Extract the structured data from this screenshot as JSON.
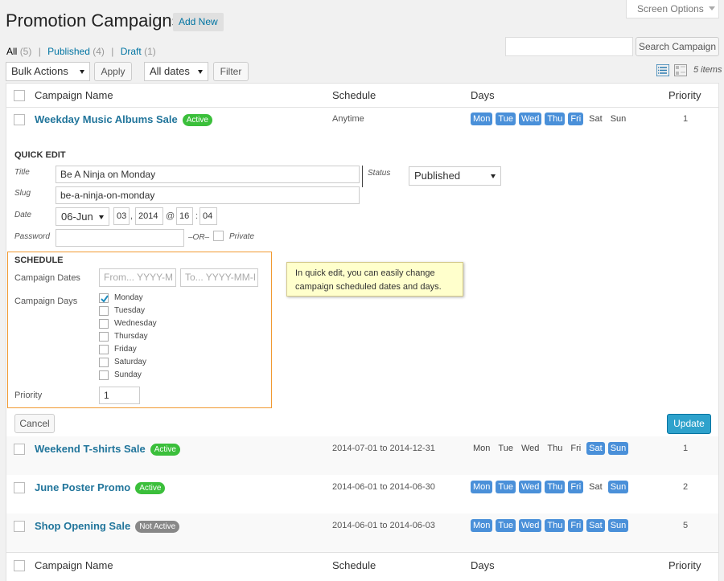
{
  "header": {
    "title": "Promotion Campaigns",
    "add_new": "Add New",
    "screen_options": "Screen Options"
  },
  "filters": {
    "all": "All",
    "all_count": "(5)",
    "published": "Published",
    "published_count": "(4)",
    "draft": "Draft",
    "draft_count": "(1)",
    "sep": "|"
  },
  "search": {
    "button": "Search Campaign",
    "value": ""
  },
  "toolbar": {
    "bulk_actions": "Bulk Actions",
    "apply": "Apply",
    "dates": "All dates",
    "filter": "Filter",
    "items": "5 items"
  },
  "columns": {
    "name": "Campaign Name",
    "schedule": "Schedule",
    "days": "Days",
    "priority": "Priority"
  },
  "day_names": [
    "Mon",
    "Tue",
    "Wed",
    "Thu",
    "Fri",
    "Sat",
    "Sun"
  ],
  "rows": [
    {
      "name": "Weekday Music Albums Sale",
      "status": "Active",
      "active": true,
      "schedule": "Anytime",
      "days": [
        1,
        1,
        1,
        1,
        1,
        0,
        0
      ],
      "priority": "1"
    },
    {
      "name": "Weekend T-shirts Sale",
      "status": "Active",
      "active": true,
      "schedule": "2014-07-01 to 2014-12-31",
      "days": [
        0,
        0,
        0,
        0,
        0,
        1,
        1
      ],
      "priority": "1"
    },
    {
      "name": "June Poster Promo",
      "status": "Active",
      "active": true,
      "schedule": "2014-06-01 to 2014-06-30",
      "days": [
        1,
        1,
        1,
        1,
        1,
        0,
        1
      ],
      "priority": "2"
    },
    {
      "name": "Shop Opening Sale",
      "status": "Not Active",
      "active": false,
      "schedule": "2014-06-01 to 2014-06-03",
      "days": [
        1,
        1,
        1,
        1,
        1,
        1,
        1
      ],
      "priority": "5"
    }
  ],
  "quick_edit": {
    "heading": "QUICK EDIT",
    "title_label": "Title",
    "title_value": "Be A Ninja on Monday",
    "slug_label": "Slug",
    "slug_value": "be-a-ninja-on-monday",
    "date_label": "Date",
    "month": "06-Jun",
    "day": "03",
    "comma": ",",
    "year": "2014",
    "at": "@",
    "hour": "16",
    "colon": ":",
    "minute": "04",
    "password_label": "Password",
    "or": "–OR–",
    "private": "Private",
    "status_label": "Status",
    "status_value": "Published",
    "schedule_heading": "SCHEDULE",
    "dates_label": "Campaign Dates",
    "from_placeholder": "From... YYYY-M",
    "to_placeholder": "To... YYYY-MM-I",
    "days_label": "Campaign Days",
    "days": [
      {
        "label": "Monday",
        "checked": true
      },
      {
        "label": "Tuesday",
        "checked": false
      },
      {
        "label": "Wednesday",
        "checked": false
      },
      {
        "label": "Thursday",
        "checked": false
      },
      {
        "label": "Friday",
        "checked": false
      },
      {
        "label": "Saturday",
        "checked": false
      },
      {
        "label": "Sunday",
        "checked": false
      }
    ],
    "priority_label": "Priority",
    "priority_value": "1",
    "cancel": "Cancel",
    "update": "Update"
  },
  "tooltip": {
    "line1": "In quick edit, you can easily change",
    "line2": "campaign scheduled dates and days."
  },
  "colors": {
    "accent": "#0074a2",
    "day_on": "#4a90d9",
    "active": "#3bbf3b",
    "inactive": "#888888",
    "highlight": "#f19a32"
  }
}
